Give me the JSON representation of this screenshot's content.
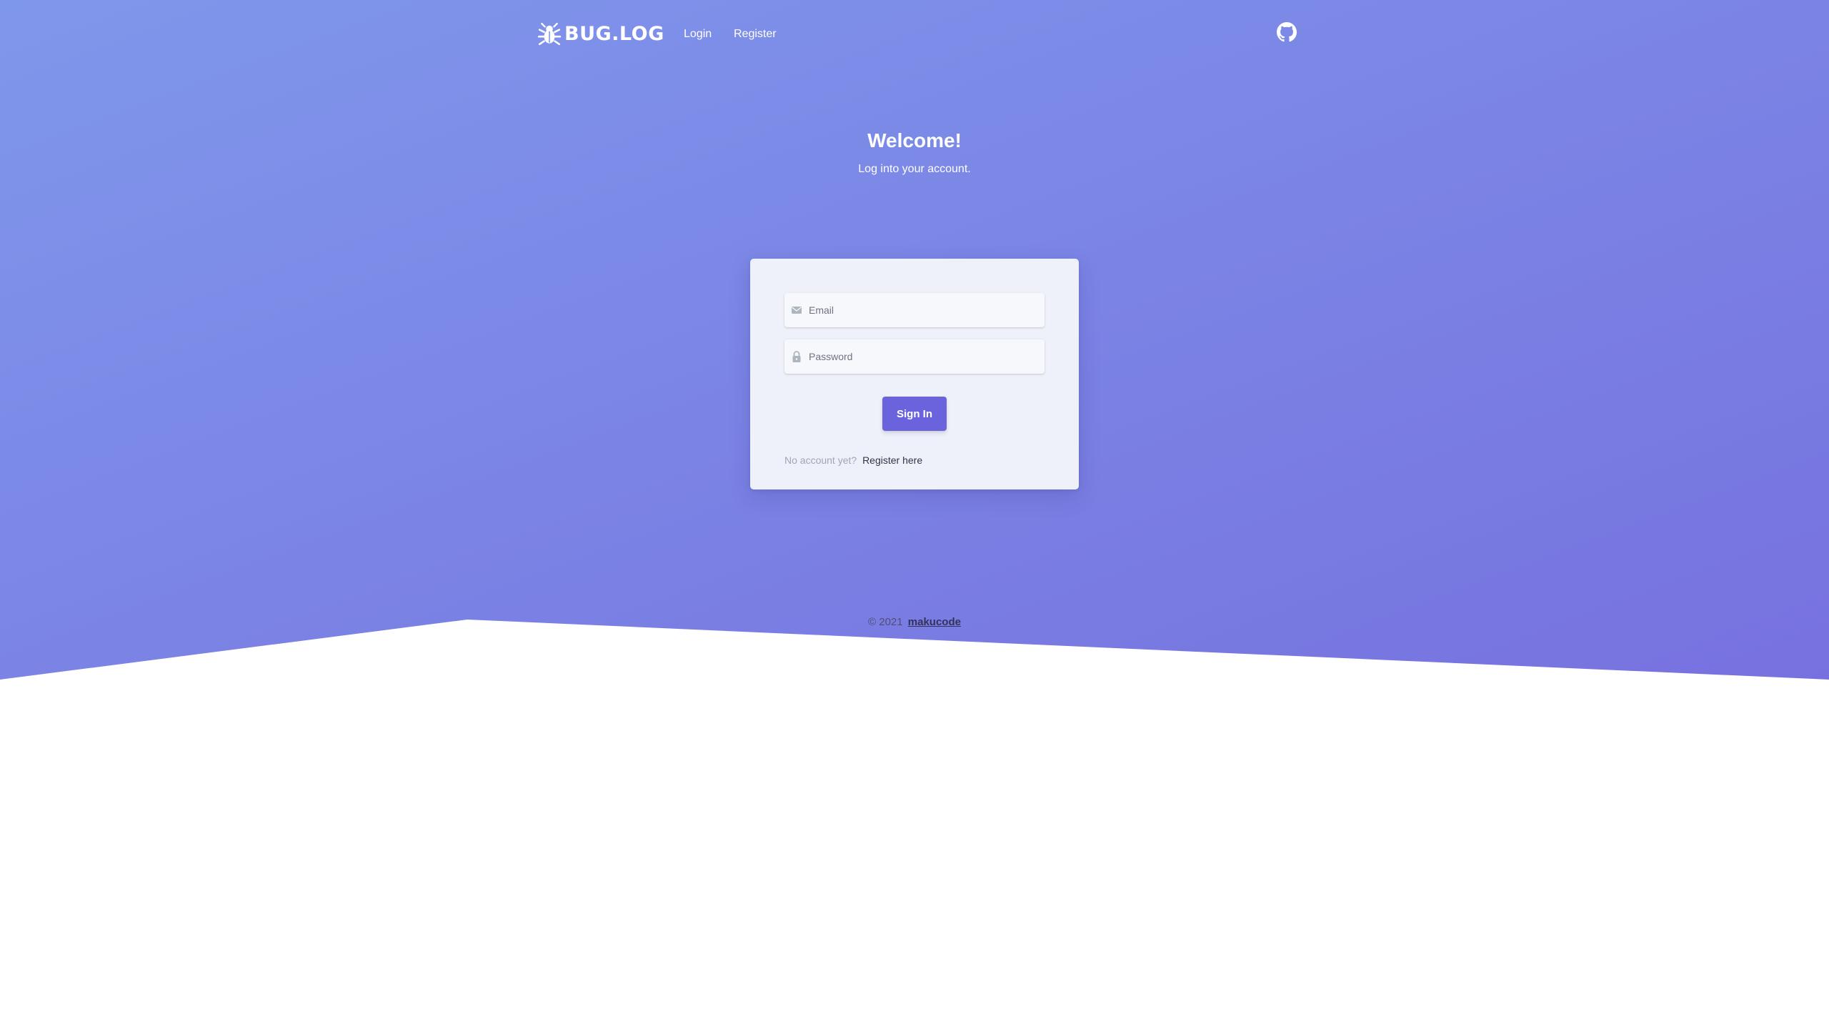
{
  "navbar": {
    "brand": "BUG.LOG",
    "links": [
      {
        "label": "Login"
      },
      {
        "label": "Register"
      }
    ],
    "icons": {
      "brand": "bug-icon",
      "github": "github-icon"
    }
  },
  "hero": {
    "title": "Welcome!",
    "subtitle": "Log into your account."
  },
  "login_form": {
    "email": {
      "placeholder": "Email",
      "value": "",
      "icon": "envelope-icon"
    },
    "password": {
      "placeholder": "Password",
      "value": "",
      "icon": "lock-icon"
    },
    "submit_label": "Sign In",
    "no_account_text": "No account yet?",
    "register_link": "Register here"
  },
  "footer": {
    "copyright": "© 2021",
    "author": "makucode"
  },
  "colors": {
    "gradient_start": "#7f97eb",
    "gradient_end": "#7771df",
    "button": "#6a63dd",
    "card": "#eef1f9"
  }
}
